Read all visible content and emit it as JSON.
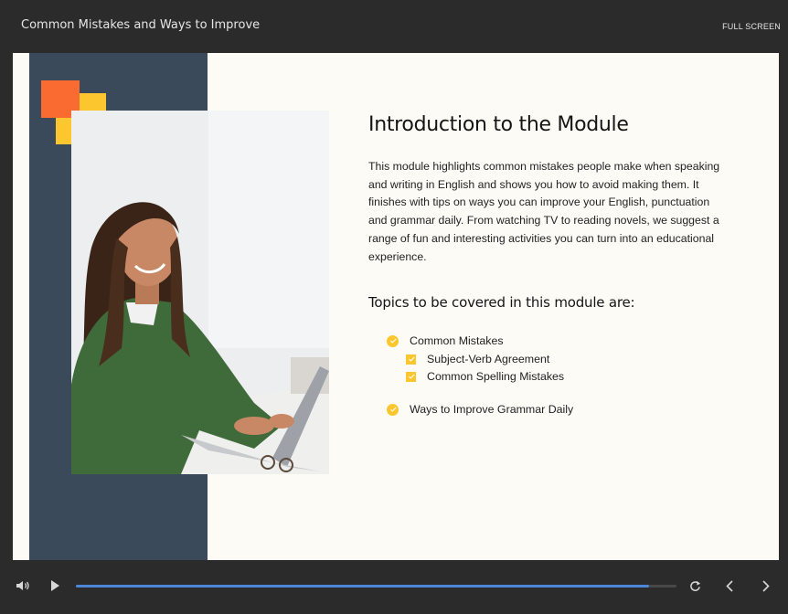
{
  "window": {
    "title": "Common Mistakes and Ways to Improve",
    "fullscreen_label": "FULL SCREEN"
  },
  "slide": {
    "heading": "Introduction to the Module",
    "paragraph": "This module highlights common mistakes people make when speaking and writing in English and shows you how to avoid making them. It finishes with tips on ways you can improve your English, punctuation and grammar daily. From watching TV to reading novels, we suggest a range of fun and interesting activities you can turn into an educational experience.",
    "topics_heading": "Topics to be covered in this module are:",
    "topics": [
      {
        "label": "Common Mistakes"
      },
      {
        "label": "Subject-Verb Agreement"
      },
      {
        "label": "Common Spelling Mistakes"
      },
      {
        "label": "Ways to Improve Grammar Daily"
      }
    ],
    "colors": {
      "navy": "#3b4a5b",
      "accent_yellow": "#fcc72e",
      "accent_orange": "#fa6b32",
      "background": "#fdfbf5"
    }
  },
  "player": {
    "progress": 0.955,
    "progress_color": "#4c86d8",
    "icons": [
      "volume-icon",
      "play-icon",
      "replay-icon",
      "chevron-left-icon",
      "chevron-right-icon"
    ]
  }
}
